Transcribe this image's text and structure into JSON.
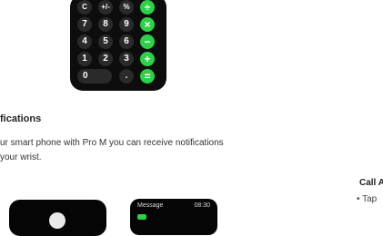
{
  "calculator": {
    "rows": [
      [
        "C",
        "+/-",
        "%",
        "÷"
      ],
      [
        "7",
        "8",
        "9",
        "×"
      ],
      [
        "4",
        "5",
        "6",
        "−"
      ],
      [
        "1",
        "2",
        "3",
        "+"
      ]
    ],
    "bottom": {
      "zero": "0",
      "dot": ".",
      "equals": "="
    }
  },
  "notifications": {
    "title": "fications",
    "line1": "ur smart phone with  Pro M you can receive notifications",
    "line2": "your wrist."
  },
  "call": {
    "title": "Call A",
    "item": "• Tap"
  },
  "message_screen": {
    "label": "Message",
    "time": "08:30"
  },
  "colors": {
    "accent_green": "#2fcf4a",
    "watch_bg": "#050505",
    "key_bg": "#2a2a2a"
  }
}
